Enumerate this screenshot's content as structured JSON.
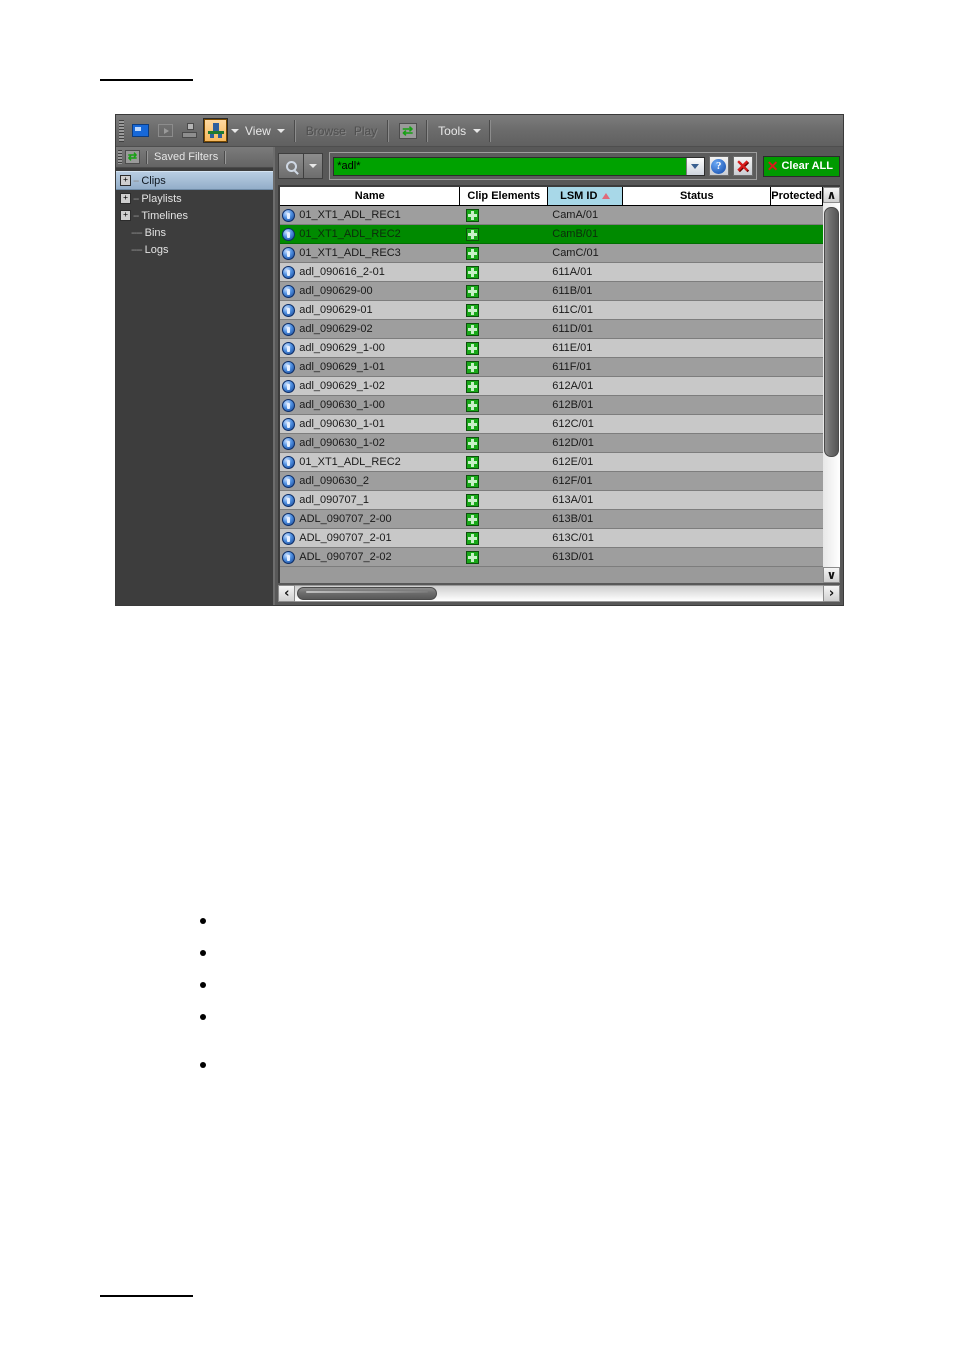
{
  "document": {
    "rule_top": "",
    "rule_bottom": ""
  },
  "app": {
    "toolbar": {
      "icons": [
        {
          "name": "monitor-icon",
          "label": ""
        },
        {
          "name": "play-box-icon",
          "label": ""
        },
        {
          "name": "export-icon",
          "label": ""
        },
        {
          "name": "clip-tool-icon",
          "label": ""
        }
      ],
      "view_label": "View",
      "browse_label": "Browse",
      "play_label": "Play",
      "tools_label": "Tools",
      "refresh_icon": "refresh-icon"
    },
    "sidebar": {
      "header_label": "Saved Filters",
      "header_icon": "refresh-icon",
      "items": [
        {
          "label": "Clips",
          "expandable": true,
          "selected": true
        },
        {
          "label": "Playlists",
          "expandable": true,
          "selected": false
        },
        {
          "label": "Timelines",
          "expandable": true,
          "selected": false
        },
        {
          "label": "Bins",
          "expandable": false,
          "selected": false
        },
        {
          "label": "Logs",
          "expandable": false,
          "selected": false
        }
      ],
      "expand_glyph": "+"
    },
    "search": {
      "magnifier_icon": "search-icon",
      "dropdown_icon": "chevron-down-icon",
      "value": "*adl*",
      "combo_arrow_icon": "chevron-down-icon",
      "help_label": "?",
      "clear_label": "✕",
      "clear_all_label": "Clear ALL",
      "clear_all_icon": "red-x-icon",
      "clear_all_color": "#009a00"
    },
    "grid": {
      "columns": [
        {
          "label": "Name",
          "sorted": false
        },
        {
          "label": "Clip Elements",
          "sorted": false
        },
        {
          "label": "LSM ID",
          "sorted": true,
          "sort_dir": "ascending"
        },
        {
          "label": "Status",
          "sorted": false
        },
        {
          "label": "Protected",
          "sorted": false
        }
      ],
      "rows": [
        {
          "name": "01_XT1_ADL_REC1",
          "elements": "clip-element-icon",
          "lsm_id": "CamA/01",
          "status": "",
          "protected": "",
          "selected": false
        },
        {
          "name": "01_XT1_ADL_REC2",
          "elements": "clip-element-icon",
          "lsm_id": "CamB/01",
          "status": "",
          "protected": "",
          "selected": true
        },
        {
          "name": "01_XT1_ADL_REC3",
          "elements": "clip-element-icon",
          "lsm_id": "CamC/01",
          "status": "",
          "protected": "",
          "selected": false
        },
        {
          "name": "adl_090616_2-01",
          "elements": "clip-element-icon",
          "lsm_id": "611A/01",
          "status": "",
          "protected": "",
          "selected": false
        },
        {
          "name": "adl_090629-00",
          "elements": "clip-element-icon",
          "lsm_id": "611B/01",
          "status": "",
          "protected": "",
          "selected": false
        },
        {
          "name": "adl_090629-01",
          "elements": "clip-element-icon",
          "lsm_id": "611C/01",
          "status": "",
          "protected": "",
          "selected": false
        },
        {
          "name": "adl_090629-02",
          "elements": "clip-element-icon",
          "lsm_id": "611D/01",
          "status": "",
          "protected": "",
          "selected": false
        },
        {
          "name": "adl_090629_1-00",
          "elements": "clip-element-icon",
          "lsm_id": "611E/01",
          "status": "",
          "protected": "",
          "selected": false
        },
        {
          "name": "adl_090629_1-01",
          "elements": "clip-element-icon",
          "lsm_id": "611F/01",
          "status": "",
          "protected": "",
          "selected": false
        },
        {
          "name": "adl_090629_1-02",
          "elements": "clip-element-icon",
          "lsm_id": "612A/01",
          "status": "",
          "protected": "",
          "selected": false
        },
        {
          "name": "adl_090630_1-00",
          "elements": "clip-element-icon",
          "lsm_id": "612B/01",
          "status": "",
          "protected": "",
          "selected": false
        },
        {
          "name": "adl_090630_1-01",
          "elements": "clip-element-icon",
          "lsm_id": "612C/01",
          "status": "",
          "protected": "",
          "selected": false
        },
        {
          "name": "adl_090630_1-02",
          "elements": "clip-element-icon",
          "lsm_id": "612D/01",
          "status": "",
          "protected": "",
          "selected": false
        },
        {
          "name": "01_XT1_ADL_REC2",
          "elements": "clip-element-icon",
          "lsm_id": "612E/01",
          "status": "",
          "protected": "",
          "selected": false
        },
        {
          "name": "adl_090630_2",
          "elements": "clip-element-icon",
          "lsm_id": "612F/01",
          "status": "",
          "protected": "",
          "selected": false
        },
        {
          "name": "adl_090707_1",
          "elements": "clip-element-icon",
          "lsm_id": "613A/01",
          "status": "",
          "protected": "",
          "selected": false
        },
        {
          "name": "ADL_090707_2-00",
          "elements": "clip-element-icon",
          "lsm_id": "613B/01",
          "status": "",
          "protected": "",
          "selected": false
        },
        {
          "name": "ADL_090707_2-01",
          "elements": "clip-element-icon",
          "lsm_id": "613C/01",
          "status": "",
          "protected": "",
          "selected": false
        },
        {
          "name": "ADL_090707_2-02",
          "elements": "clip-element-icon",
          "lsm_id": "613D/01",
          "status": "",
          "protected": "",
          "selected": false
        }
      ],
      "scroll_up_glyph": "∧",
      "scroll_down_glyph": "∨",
      "scroll_left_glyph": "‹",
      "scroll_right_glyph": "›"
    }
  }
}
